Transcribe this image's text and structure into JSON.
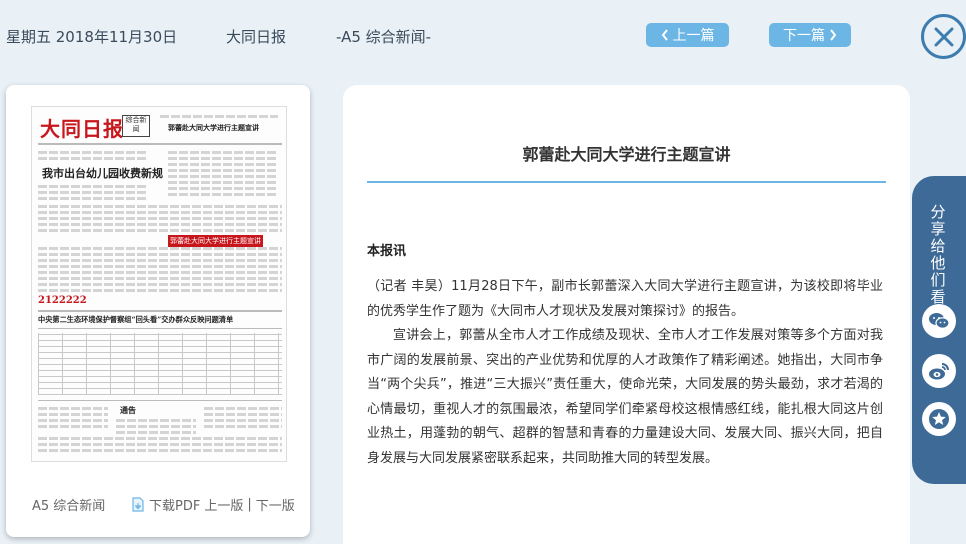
{
  "header": {
    "date": "星期五 2018年11月30日",
    "paper": "大同日报",
    "section": "-A5 综合新闻-",
    "prev_label": "上一篇",
    "next_label": "下一篇"
  },
  "page_card": {
    "section_label": "A5 综合新闻",
    "download_label": "下载PDF",
    "prev_page": "上一版",
    "separator": "|",
    "next_page": "下一版",
    "thumbnail": {
      "masthead": "大同日报",
      "badge": "综合新闻",
      "headline_main": "我市出台幼儿园收费新规",
      "headline_2": "中央第二生态环境保护督察组“回头看”交办群众反映问题清单",
      "headline_3": "郭蕾赴大同大学进行主题宣讲",
      "number": "2122222",
      "notice": "通告"
    }
  },
  "article": {
    "title": "郭蕾赴大同大学进行主题宣讲",
    "source": "本报讯",
    "paragraphs": [
      "（记者 丰昊）11月28日下午，副市长郭蕾深入大同大学进行主题宣讲，为该校即将毕业的优秀学生作了题为《大同市人才现状及发展对策探讨》的报告。",
      "宣讲会上，郭蕾从全市人才工作成绩及现状、全市人才工作发展对策等多个方面对我市广阔的发展前景、突出的产业优势和优厚的人才政策作了精彩阐述。她指出，大同市争当“两个尖兵”，推进“三大振兴”责任重大，使命光荣，大同发展的势头最劲，求才若渴的心情最切，重视人才的氛围最浓，希望同学们牵紧母校这根情感红线，能扎根大同这片创业热土，用蓬勃的朝气、超群的智慧和青春的力量建设大同、发展大同、振兴大同，把自身发展与大同发展紧密联系起来，共同助推大同的转型发展。"
    ]
  },
  "share": {
    "title": "分享给他们看看",
    "icons": [
      "wechat-icon",
      "weibo-icon",
      "favorite-icon"
    ]
  },
  "colors": {
    "background": "#e9f1f7",
    "accent": "#6cb6e6",
    "share_panel": "#3d6a96",
    "close_ring": "#3d7cae",
    "masthead_red": "#c8161d"
  }
}
